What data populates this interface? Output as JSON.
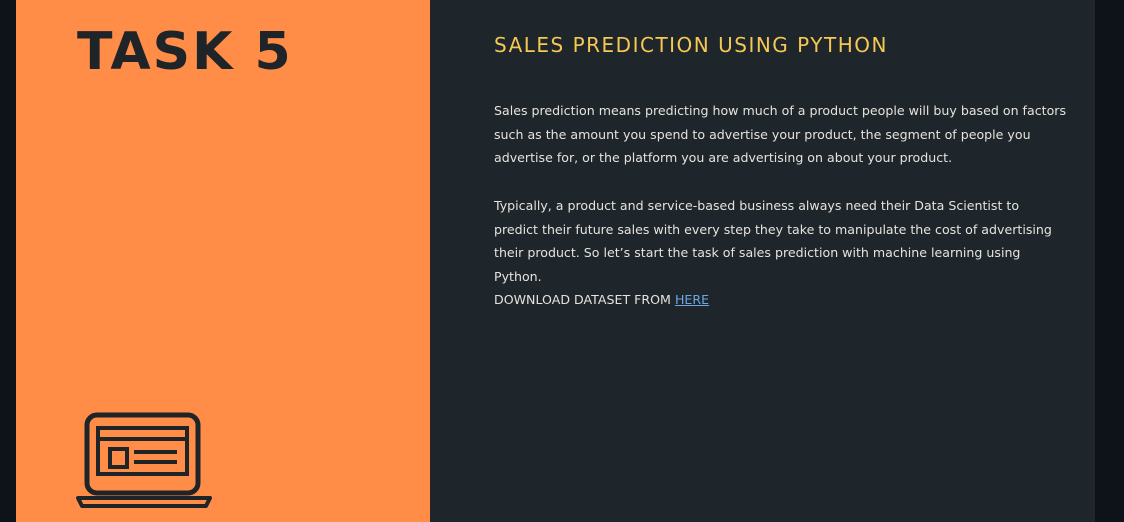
{
  "task": {
    "title": "TASK 5"
  },
  "content": {
    "heading": "SALES PREDICTION USING PYTHON",
    "paragraphs": [
      "Sales prediction means predicting how much of a product people will buy based on factors such as the amount you spend to advertise your product, the segment of people you advertise for, or the platform you are advertising on about your product.",
      "Typically, a product and service-based business always need their Data Scientist to predict their future sales with every step they take to manipulate the cost of advertising their product. So let’s start the task of sales prediction with machine learning using Python."
    ],
    "download_prefix": "DOWNLOAD DATASET FROM ",
    "download_link_text": "HERE"
  },
  "icons": {
    "illustration": "laptop-icon"
  },
  "colors": {
    "left_panel": "#ff8c47",
    "right_panel": "#1e252b",
    "heading": "#f5c753",
    "body_text": "#e6e3dc",
    "link": "#6fa6e0",
    "page_bg": "#0d1318"
  }
}
